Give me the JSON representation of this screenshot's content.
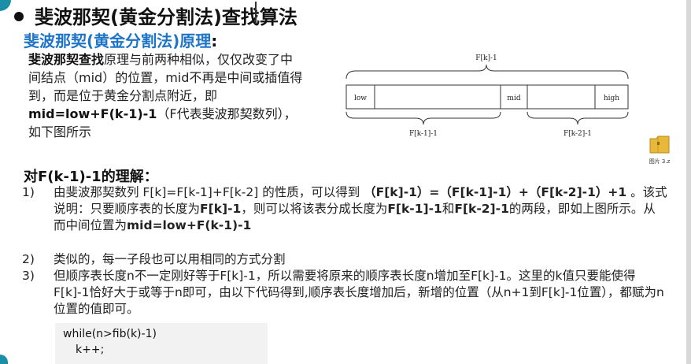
{
  "heading": "斐波那契(黄金分割法)查找算法",
  "principle": {
    "title": "斐波那契(黄金分割法)原理",
    "colon": ":"
  },
  "intro": {
    "bold1": "斐波那契查找",
    "text1": "原理与前两种相似，仅仅改变了中间结点（mid）的位置，mid不再是中间或插值得到，而是位于黄金分割点附近，即",
    "bold2": "mid=low+F(k-1)-1",
    "text2": "（F代表斐波那契数列），如下图所示"
  },
  "diagram": {
    "top_label": "F[k]-1",
    "low": "low",
    "mid": "mid",
    "high": "high",
    "left_label": "F[k-1]-1",
    "right_label": "F[k-2]-1"
  },
  "understanding": {
    "title": "对F(k-1)-1的理解：",
    "items": [
      {
        "num": "1)",
        "t1": "由斐波那契数列 F[k]=F[k-1]+F[k-2] 的性质，可以得到 ",
        "b1": "（F[k]-1）=（F[k-1]-1）+（F[k-2]-1）+1",
        "t2": " 。该式说明：只要顺序表的长度为",
        "b2": "F[k]-1",
        "t3": "，则可以将该表分成长度为",
        "b3": "F[k-1]-1",
        "t4": "和",
        "b4": "F[k-2]-1",
        "t5": "的两段，即如上图所示。从而中间位置为",
        "b5": "mid=low+F(k-1)-1"
      },
      {
        "num": "2)",
        "text": "类似的，每一子段也可以用相同的方式分割"
      },
      {
        "num": "3)",
        "text": "但顺序表长度n不一定刚好等于F[k]-1，所以需要将原来的顺序表长度n增加至F[k]-1。这里的k值只要能使得F[k]-1恰好大于或等于n即可，由以下代码得到,顺序表长度增加后，新增的位置（从n+1到F[k]-1位置），都赋为n位置的值即可。"
      }
    ]
  },
  "code": {
    "line1": "while(n>fib(k)-1)",
    "line2": "k++;"
  },
  "file_icon": {
    "name": "folder-icon",
    "label": "图片 3.z",
    "color": "#e8b83a"
  }
}
